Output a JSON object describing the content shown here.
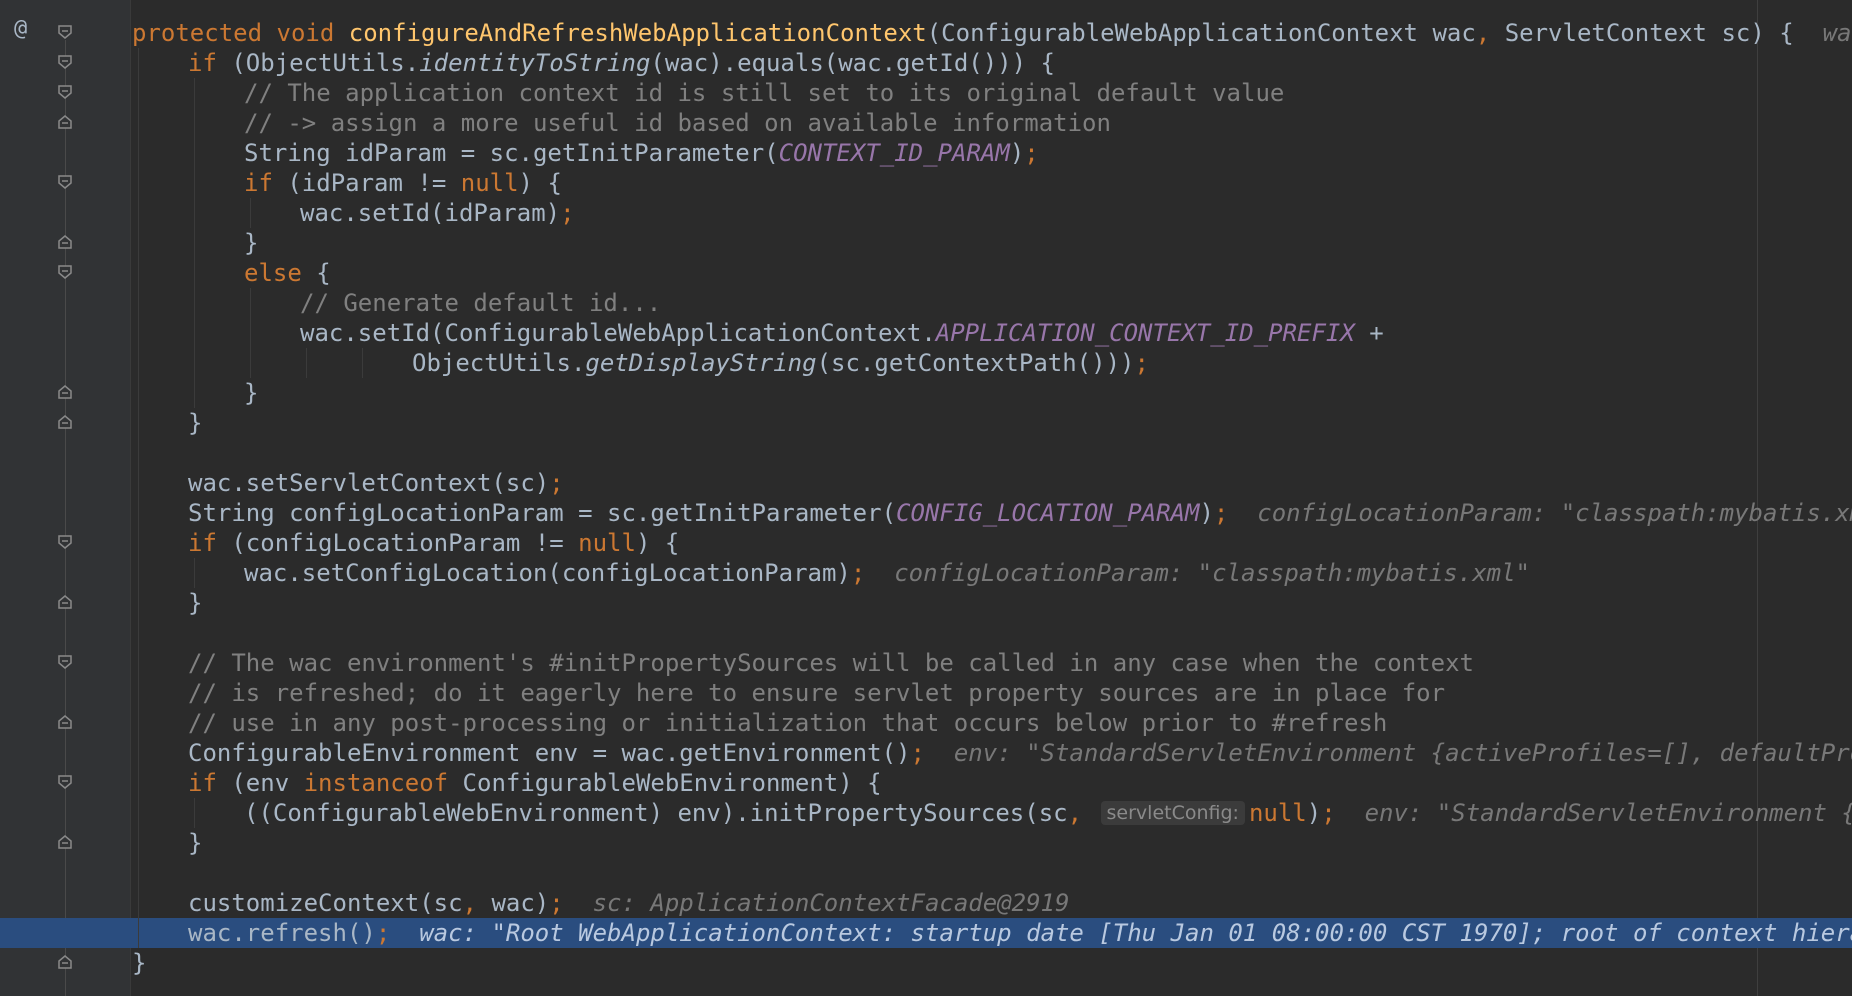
{
  "gutter": {
    "override_marker": "@"
  },
  "code": {
    "l1": {
      "mod": "protected",
      "type": "void",
      "name": "configureAndRefreshWebApplicationContext",
      "open": "(ConfigurableWebApplicationContext wac",
      "comma": ",",
      "rest": " ServletContext sc) {  ",
      "hint": "wac: \""
    },
    "l2": {
      "kw": "if",
      "a": " (ObjectUtils.",
      "m": "identityToString",
      "b": "(wac).equals(wac.getId())) {"
    },
    "l3": {
      "comment": "// The application context id is still set to its original default value"
    },
    "l4": {
      "comment": "// -> assign a more useful id based on available information"
    },
    "l5": {
      "a": "String idParam = sc.getInitParameter(",
      "const": "CONTEXT_ID_PARAM",
      "b": ")",
      "semi": ";"
    },
    "l6": {
      "kw": "if",
      "a": " (idParam != ",
      "null": "null",
      "b": ") {"
    },
    "l7": {
      "a": "wac.setId(idParam)",
      "semi": ";"
    },
    "l8": {
      "a": "}"
    },
    "l9": {
      "kw": "else",
      "a": " {"
    },
    "l10": {
      "comment": "// Generate default id..."
    },
    "l11": {
      "a": "wac.setId(ConfigurableWebApplicationContext.",
      "const": "APPLICATION_CONTEXT_ID_PREFIX",
      "b": " +"
    },
    "l12": {
      "a": "ObjectUtils.",
      "m": "getDisplayString",
      "b": "(sc.getContextPath()))",
      "semi": ";"
    },
    "l13": {
      "a": "}"
    },
    "l14": {
      "a": "}"
    },
    "l16": {
      "a": "wac.setServletContext(sc)",
      "semi": ";"
    },
    "l17": {
      "a": "String configLocationParam = sc.getInitParameter(",
      "const": "CONFIG_LOCATION_PARAM",
      "b": ")",
      "semi": ";",
      "hint": "configLocationParam: \"classpath:mybatis.xml\""
    },
    "l18": {
      "kw": "if",
      "a": " (configLocationParam != ",
      "null": "null",
      "b": ") {"
    },
    "l19": {
      "a": "wac.setConfigLocation(configLocationParam)",
      "semi": ";",
      "hint": "configLocationParam: \"classpath:mybatis.xml\""
    },
    "l20": {
      "a": "}"
    },
    "l22": {
      "comment": "// The wac environment's #initPropertySources will be called in any case when the context"
    },
    "l23": {
      "comment": "// is refreshed; do it eagerly here to ensure servlet property sources are in place for"
    },
    "l24": {
      "comment": "// use in any post-processing or initialization that occurs below prior to #refresh"
    },
    "l25": {
      "a": "ConfigurableEnvironment env = wac.getEnvironment()",
      "semi": ";",
      "hint": "env: \"StandardServletEnvironment {activeProfiles=[], defaultProfil"
    },
    "l26": {
      "kw": "if",
      "a": " (env ",
      "kw2": "instanceof",
      "b": " ConfigurableWebEnvironment) {"
    },
    "l27": {
      "a": "((ConfigurableWebEnvironment) env).initPropertySources(sc",
      "comma": ",",
      "param_hint": "servletConfig:",
      "null": "null",
      "b": ")",
      "semi": ";",
      "hint": "env: \"StandardServletEnvironment {ac"
    },
    "l28": {
      "a": "}"
    },
    "l30": {
      "a": "customizeContext(sc",
      "comma": ",",
      "b": " wac)",
      "semi": ";",
      "hint": "sc: ApplicationContextFacade@2919"
    },
    "l31": {
      "a": "wac.refresh()",
      "semi": ";",
      "hint": "wac: \"Root WebApplicationContext: startup date [Thu Jan 01 08:00:00 CST 1970]; root of context hierarch"
    },
    "l32": {
      "a": "}"
    }
  }
}
